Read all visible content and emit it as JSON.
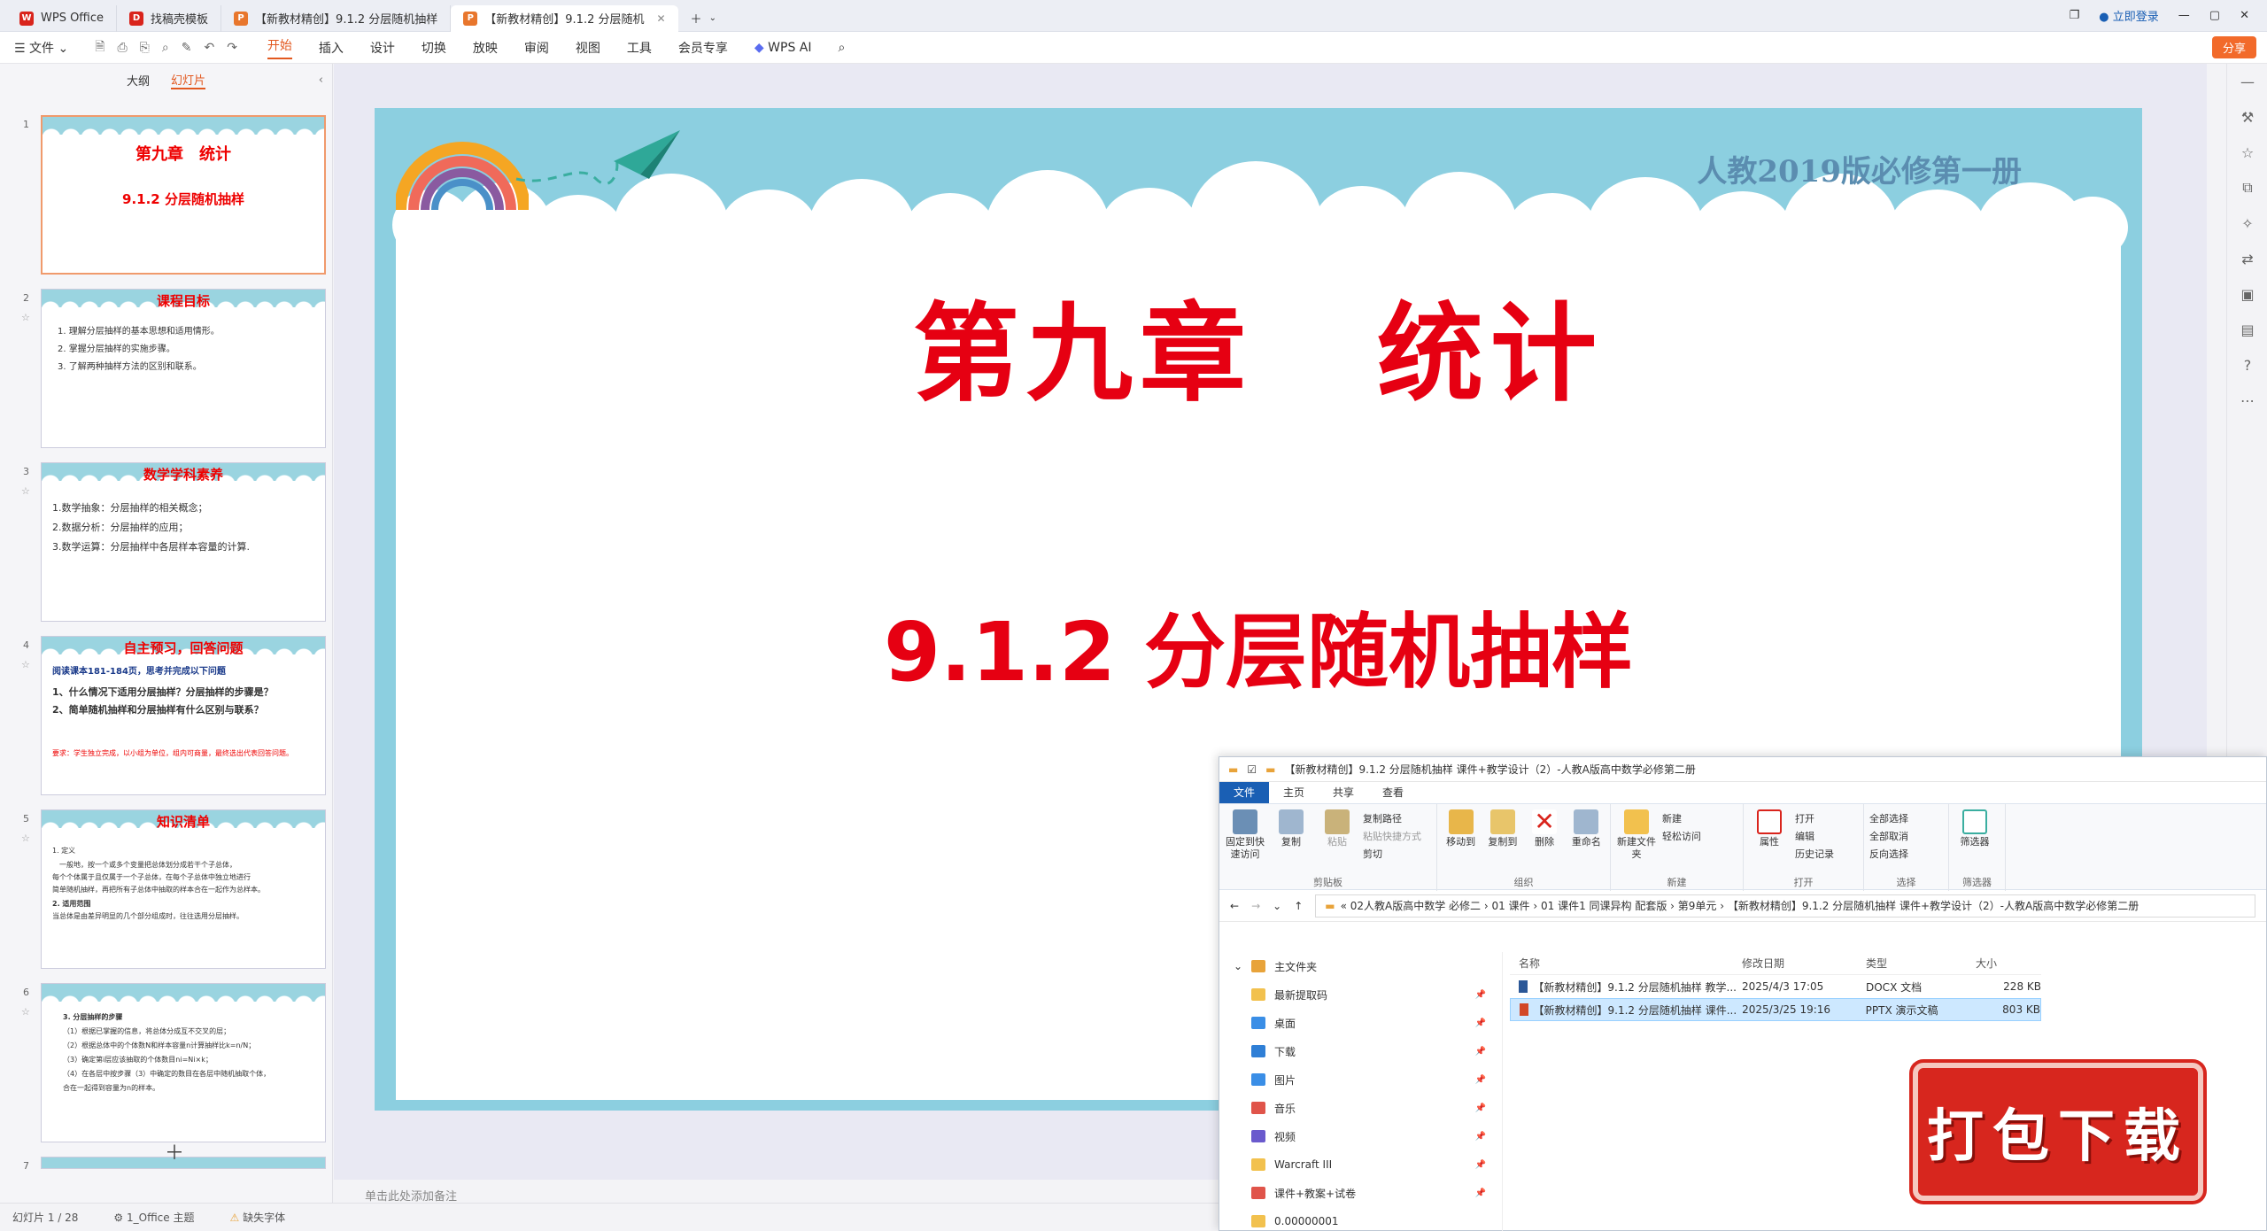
{
  "tabs": [
    {
      "label": "WPS Office",
      "color": "#d9241c",
      "glyph": "W"
    },
    {
      "label": "找稿壳模板",
      "color": "#d9241c",
      "glyph": "D"
    },
    {
      "label": "【新教材精创】9.1.2 分层随机抽样",
      "color": "#e8762c",
      "glyph": "P"
    },
    {
      "label": "【新教材精创】9.1.2 分层随机",
      "color": "#e8762c",
      "glyph": "P"
    }
  ],
  "login": "立即登录",
  "menu": {
    "file": "文件",
    "items": [
      "开始",
      "插入",
      "设计",
      "切换",
      "放映",
      "审阅",
      "视图",
      "工具",
      "会员专享"
    ],
    "wps_ai": "WPS AI",
    "share": "分享"
  },
  "panel": {
    "tab_outline": "大纲",
    "tab_slides": "幻灯片"
  },
  "thumbs": [
    {
      "num": "1",
      "title": "第九章　统计",
      "sub": "9.1.2 分层随机抽样",
      "tag": "人教2019版必修第一册"
    },
    {
      "num": "2",
      "title": "课程目标",
      "lines": [
        "1.  理解分层抽样的基本思想和适用情形。",
        "2.  掌握分层抽样的实施步骤。",
        "3.  了解两种抽样方法的区别和联系。"
      ]
    },
    {
      "num": "3",
      "title": "数学学科素养",
      "lines": [
        "1.数学抽象：分层抽样的相关概念；",
        "2.数据分析：分层抽样的应用；",
        "3.数学运算：分层抽样中各层样本容量的计算."
      ]
    },
    {
      "num": "4",
      "title": "自主预习，回答问题",
      "lines": [
        "阅读课本181-184页，思考并完成以下问题",
        "1、什么情况下适用分层抽样？分层抽样的步骤是？",
        "2、简单随机抽样和分层抽样有什么区别与联系？",
        "要求：学生独立完成，以小组为单位，组内可商量，最终选出代表回答问题。"
      ]
    },
    {
      "num": "5",
      "title": "知识清单",
      "lines": [
        "1.  定义",
        "一般地，按一个或多个变量把总体划分成若干个子总体，",
        "每个个体属于且仅属于一个子总体，在每个子总体中独立地进行",
        "简单随机抽样，再把所有子总体中抽取的样本合在一起作为总样本。",
        "2.  适用范围",
        "当总体是由差异明显的几个部分组成时，往往选用分层抽样。"
      ]
    },
    {
      "num": "6",
      "title": "",
      "lines": [
        "3.  分层抽样的步骤",
        "（1）根据已掌握的信息，将总体分成互不交叉的层；",
        "（2）根据总体中的个体数N和样本容量n计算抽样比k=n/N；",
        "（3）确定第i层应该抽取的个体数目ni=Ni×k；",
        "（4）在各层中按步骤（3）中确定的数目在各层中随机抽取个体，",
        "合在一起得到容量为n的样本。"
      ]
    },
    {
      "num": "7"
    }
  ],
  "slide": {
    "chapter_left": "第九章",
    "chapter_right": "统计",
    "subtitle": "9.1.2 分层随机抽样",
    "edition": "人教2019版必修第一册"
  },
  "notes_placeholder": "单击此处添加备注",
  "status": {
    "slide_counter": "幻灯片 1 / 28",
    "theme": "1_Office 主题",
    "fonts": "缺失字体"
  },
  "explorer": {
    "title": "【新教材精创】9.1.2 分层随机抽样 课件+教学设计（2）-人教A版高中数学必修第二册",
    "tabs": [
      "文件",
      "主页",
      "共享",
      "查看"
    ],
    "ribbon": {
      "clipboard": {
        "label": "剪贴板",
        "pin": "固定到快速访问",
        "copy": "复制",
        "paste": "粘贴",
        "copy_path": "复制路径",
        "paste_shortcut": "粘贴快捷方式",
        "cut": "剪切"
      },
      "organize": {
        "label": "组织",
        "move_to": "移动到",
        "copy_to": "复制到",
        "delete": "删除",
        "rename": "重命名"
      },
      "new": {
        "label": "新建",
        "new_folder": "新建文件夹",
        "new_item": "新建",
        "easy_access": "轻松访问"
      },
      "open": {
        "label": "打开",
        "properties": "属性",
        "open": "打开",
        "edit": "编辑",
        "history": "历史记录"
      },
      "select": {
        "label": "选择",
        "all": "全部选择",
        "none": "全部取消",
        "invert": "反向选择"
      },
      "filter": {
        "label": "筛选器",
        "filter": "筛选器"
      }
    },
    "path": "«  02人教A版高中数学 必修二  ›  01 课件  ›  01 课件1 同课异构 配套版  ›  第9单元  ›  【新教材精创】9.1.2 分层随机抽样 课件+教学设计（2）-人教A版高中数学必修第二册",
    "nav": [
      {
        "label": "主文件夹",
        "color": "#e8a33a"
      },
      {
        "label": "最新提取码",
        "color": "#f2c14e"
      },
      {
        "label": "桌面",
        "color": "#3a8ee6"
      },
      {
        "label": "下载",
        "color": "#2f7fd6"
      },
      {
        "label": "图片",
        "color": "#3a8ee6"
      },
      {
        "label": "音乐",
        "color": "#e0544a"
      },
      {
        "label": "视频",
        "color": "#6a5acd"
      },
      {
        "label": "Warcraft III",
        "color": "#f2c14e"
      },
      {
        "label": "课件+教案+试卷",
        "color": "#e0544a"
      },
      {
        "label": "0.00000001",
        "color": "#f2c14e"
      }
    ],
    "columns": [
      "名称",
      "修改日期",
      "类型",
      "大小"
    ],
    "files": [
      {
        "name": "【新教材精创】9.1.2 分层随机抽样 教学...",
        "date": "2025/4/3 17:05",
        "type": "DOCX 文档",
        "size": "228 KB",
        "color": "#2b5797"
      },
      {
        "name": "【新教材精创】9.1.2 分层随机抽样 课件...",
        "date": "2025/3/25 19:16",
        "type": "PPTX 演示文稿",
        "size": "803 KB",
        "color": "#d24726"
      }
    ]
  },
  "download_badge": "打包下载"
}
